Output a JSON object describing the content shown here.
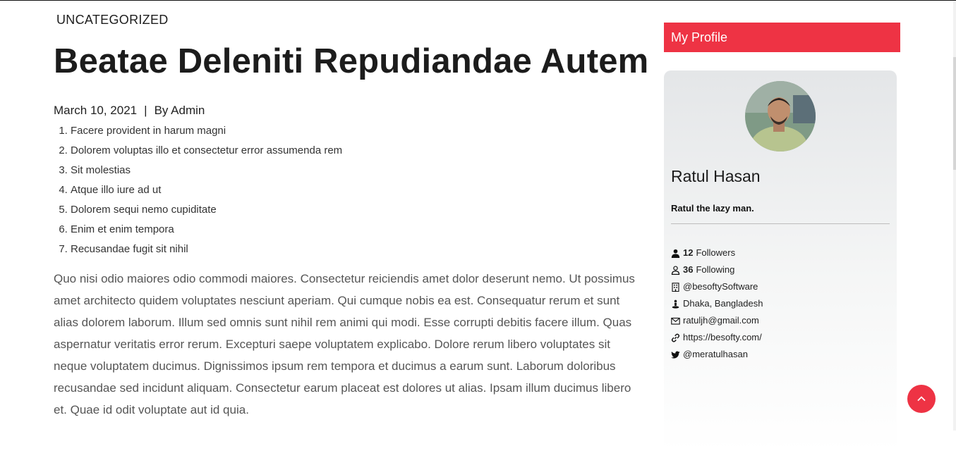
{
  "post": {
    "category": "UNCATEGORIZED",
    "title": "Beatae Deleniti Repudiandae Autem",
    "date": "March 10, 2021",
    "separator": "|",
    "author": "By Admin",
    "list": [
      "Facere provident in harum magni",
      "Dolorem voluptas illo et consectetur error assumenda rem",
      "Sit molestias",
      "Atque illo iure ad ut",
      "Dolorem sequi nemo cupiditate",
      "Enim et enim tempora",
      "Recusandae fugit sit nihil"
    ],
    "body": "Quo nisi odio maiores odio commodi maiores. Consectetur reiciendis amet dolor deserunt nemo. Ut possimus amet architecto quidem voluptates nesciunt aperiam. Qui cumque nobis ea est. Consequatur rerum et sunt alias dolorem laborum. Illum sed omnis sunt nihil rem animi qui modi. Esse corrupti debitis facere illum. Quas aspernatur veritatis error rerum. Excepturi saepe voluptatem explicabo. Dolore rerum libero voluptates sit neque voluptatem ducimus. Dignissimos ipsum rem tempora et ducimus a earum sunt. Laborum doloribus recusandae sed incidunt aliquam. Consectetur earum placeat est dolores ut alias. Ipsam illum ducimus libero et. Quae id odit voluptate aut id quia."
  },
  "sidebar": {
    "heading": "My Profile",
    "profile": {
      "name": "Ratul Hasan",
      "tagline": "Ratul the lazy man.",
      "followers_count": "12",
      "followers_label": "Followers",
      "following_count": "36",
      "following_label": "Following",
      "company": "@besoftySoftware",
      "location": "Dhaka, Bangladesh",
      "email": "ratuljh@gmail.com",
      "website": "https://besofty.com/",
      "twitter": "@meratulhasan"
    }
  },
  "colors": {
    "accent": "#ee3344",
    "title": "#1c1c1c",
    "body": "#555555"
  },
  "icons": {
    "followers": "user-solid-icon",
    "following": "user-outline-icon",
    "company": "building-icon",
    "location": "location-pin-icon",
    "email": "envelope-icon",
    "website": "link-icon",
    "twitter": "twitter-icon",
    "scroll_top": "chevron-up-icon"
  }
}
